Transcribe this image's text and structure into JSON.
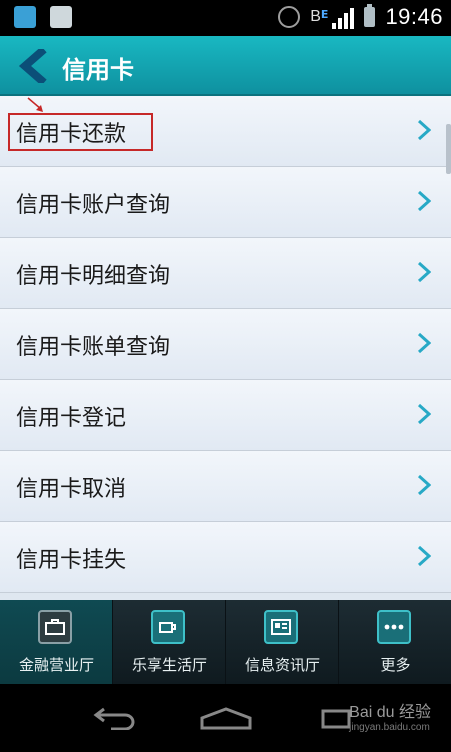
{
  "status_bar": {
    "time": "19:46",
    "network_letter": "B",
    "network_type": "E"
  },
  "header": {
    "title": "信用卡"
  },
  "menu": {
    "items": [
      {
        "label": "信用卡还款"
      },
      {
        "label": "信用卡账户查询"
      },
      {
        "label": "信用卡明细查询"
      },
      {
        "label": "信用卡账单查询"
      },
      {
        "label": "信用卡登记"
      },
      {
        "label": "信用卡取消"
      },
      {
        "label": "信用卡挂失"
      }
    ]
  },
  "tabs": [
    {
      "label": "金融营业厅",
      "icon": "briefcase-icon"
    },
    {
      "label": "乐享生活厅",
      "icon": "coffee-cup-icon"
    },
    {
      "label": "信息资讯厅",
      "icon": "newspaper-icon"
    },
    {
      "label": "更多",
      "icon": "more-dots-icon"
    }
  ],
  "watermark": {
    "brand": "Bai du 经验",
    "url": "jingyan.baidu.com"
  },
  "colors": {
    "accent": "#14a8b4",
    "highlight": "#c62828",
    "chevron": "#27a9c6"
  }
}
